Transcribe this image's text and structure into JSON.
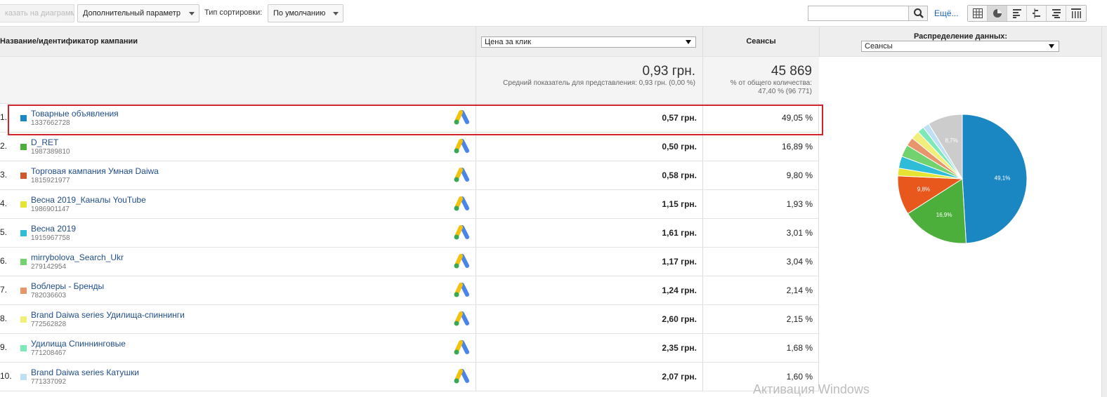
{
  "toolbar": {
    "plot_button": "казать на диаграмме",
    "secondary_dimension": "Дополнительный параметр",
    "sort_label": "Тип сортировки:",
    "sort_value": "По умолчанию",
    "search_placeholder": "",
    "more_link": "Ещё...",
    "views": [
      "data-table-icon",
      "pie-chart-icon",
      "performance-icon",
      "comparison-icon",
      "term-cloud-icon",
      "pivot-icon"
    ]
  },
  "table": {
    "name_header": "Название/идентификатор кампании",
    "metric_select": "Цена за клик",
    "sessions_header": "Сеансы",
    "distribution_header": "Распределение данных:",
    "distribution_select": "Сеансы",
    "summary": {
      "metric_value": "0,93 грн.",
      "metric_note": "Средний показатель для представления: 0,93 грн. (0,00 %)",
      "sessions_value": "45 869",
      "sessions_note1": "% от общего количества:",
      "sessions_note2": "47,40 % (96 771)"
    },
    "rows": [
      {
        "idx": "1.",
        "color": "#1a87c2",
        "name": "Товарные объявления",
        "id": "1337662728",
        "cpc": "0,57 грн.",
        "sessions": "49,05 %"
      },
      {
        "idx": "2.",
        "color": "#4caf3c",
        "name": "D_RET",
        "id": "1987389810",
        "cpc": "0,50 грн.",
        "sessions": "16,89 %"
      },
      {
        "idx": "3.",
        "color": "#d0582b",
        "name": "Торговая кампания Умная Daiwa",
        "id": "1815921977",
        "cpc": "0,58 грн.",
        "sessions": "9,80 %"
      },
      {
        "idx": "4.",
        "color": "#e6e433",
        "name": "Весна 2019_Каналы YouTube",
        "id": "1986901147",
        "cpc": "1,15 грн.",
        "sessions": "1,93 %"
      },
      {
        "idx": "5.",
        "color": "#2fbcd6",
        "name": "Весна 2019",
        "id": "1915967758",
        "cpc": "1,61 грн.",
        "sessions": "3,01 %"
      },
      {
        "idx": "6.",
        "color": "#72d36e",
        "name": "mirrybolova_Search_Ukr",
        "id": "279142954",
        "cpc": "1,17 грн.",
        "sessions": "3,04 %"
      },
      {
        "idx": "7.",
        "color": "#e8956b",
        "name": "Воблеры - Бренды",
        "id": "782036603",
        "cpc": "1,24 грн.",
        "sessions": "2,14 %"
      },
      {
        "idx": "8.",
        "color": "#f2ee7a",
        "name": "Brand Daiwa series Удилища-спиннинги",
        "id": "772562828",
        "cpc": "2,60 грн.",
        "sessions": "2,15 %"
      },
      {
        "idx": "9.",
        "color": "#7de8b8",
        "name": "Удилища Спиннинговые",
        "id": "771208467",
        "cpc": "2,35 грн.",
        "sessions": "1,68 %"
      },
      {
        "idx": "10.",
        "color": "#bfe0f3",
        "name": "Brand Daiwa series Катушки",
        "id": "771337092",
        "cpc": "2,07 грн.",
        "sessions": "1,60 %"
      }
    ]
  },
  "pie": {
    "slices": [
      {
        "value": 49.05,
        "color": "#1a87c2",
        "label": "49,1%"
      },
      {
        "value": 16.89,
        "color": "#4caf3c",
        "label": "16,9%"
      },
      {
        "value": 9.8,
        "color": "#e8571c",
        "label": "9,8%"
      },
      {
        "value": 1.93,
        "color": "#e6e433",
        "label": ""
      },
      {
        "value": 3.01,
        "color": "#2fbcd6",
        "label": ""
      },
      {
        "value": 3.04,
        "color": "#72d36e",
        "label": ""
      },
      {
        "value": 2.14,
        "color": "#e8956b",
        "label": ""
      },
      {
        "value": 2.15,
        "color": "#f2ee7a",
        "label": ""
      },
      {
        "value": 1.68,
        "color": "#7de8b8",
        "label": ""
      },
      {
        "value": 1.6,
        "color": "#bfe0f3",
        "label": ""
      },
      {
        "value": 8.71,
        "color": "#cccccc",
        "label": "8,7%"
      }
    ]
  },
  "watermark": "Активация Windows"
}
